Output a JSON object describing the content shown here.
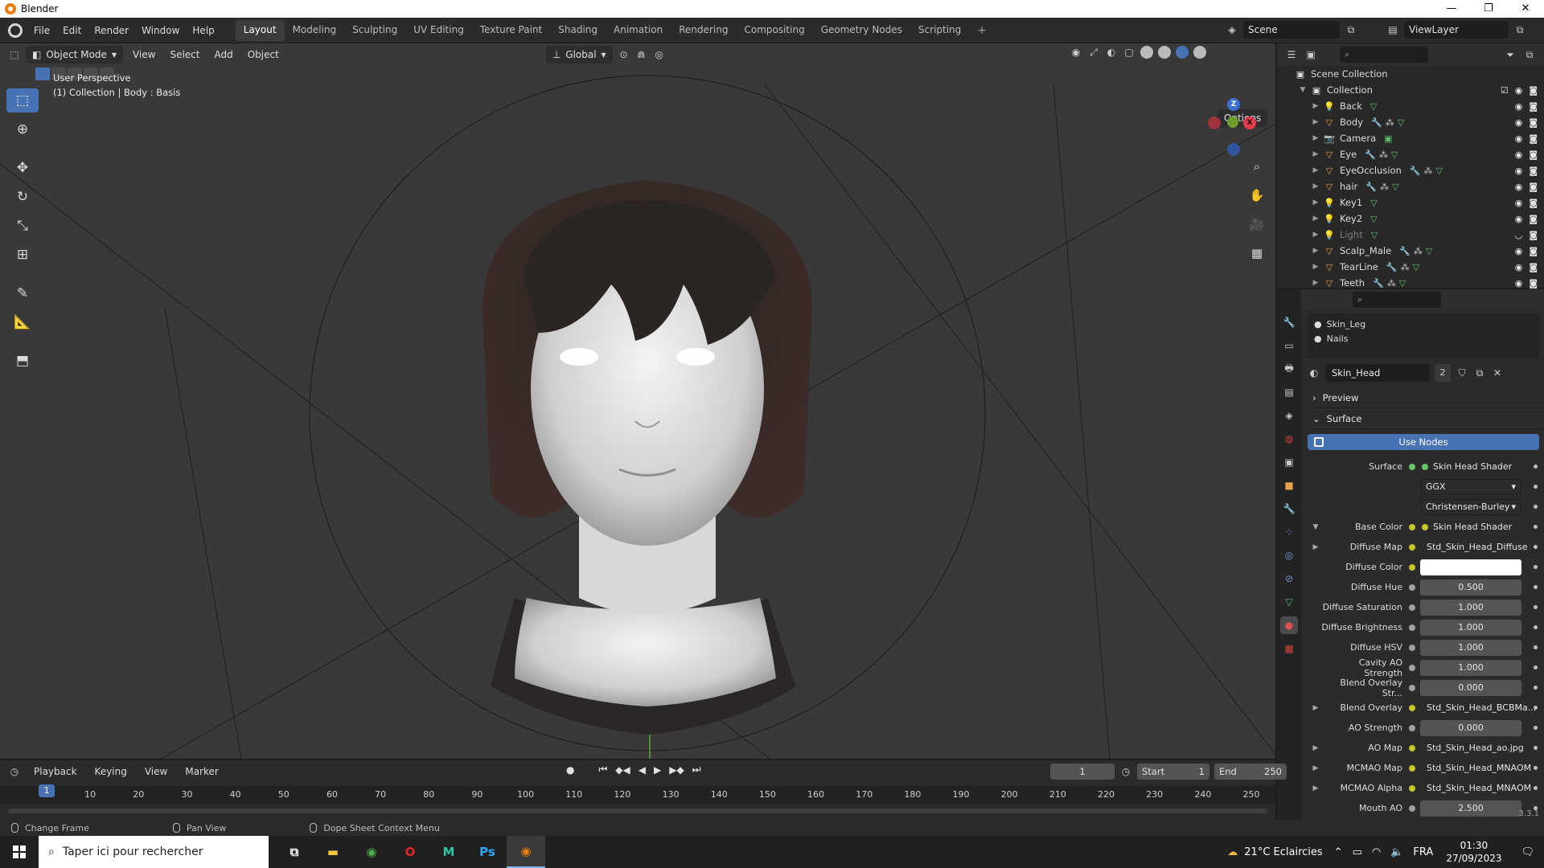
{
  "window": {
    "title": "Blender",
    "controls": [
      "—",
      "❐",
      "✕"
    ]
  },
  "menubar": {
    "menus": [
      "File",
      "Edit",
      "Render",
      "Window",
      "Help"
    ],
    "workspaces": [
      "Layout",
      "Modeling",
      "Sculpting",
      "UV Editing",
      "Texture Paint",
      "Shading",
      "Animation",
      "Rendering",
      "Compositing",
      "Geometry Nodes",
      "Scripting"
    ],
    "active_workspace": "Layout",
    "add_tab": "+",
    "scene": "Scene",
    "view_layer": "ViewLayer"
  },
  "viewport": {
    "mode": "Object Mode",
    "menus": [
      "View",
      "Select",
      "Add",
      "Object"
    ],
    "transform_orientation": "Global",
    "options_label": "Options",
    "info_line1": "User Perspective",
    "info_line2": "(1) Collection | Body : Basis",
    "gizmo": {
      "x": "X",
      "y": "Y",
      "z": "Z"
    },
    "tools": [
      "select-box-icon",
      "cursor-icon",
      "move-icon",
      "rotate-icon",
      "scale-icon",
      "transform-icon",
      "annotate-icon",
      "measure-icon",
      "add-cube-icon"
    ]
  },
  "outliner": {
    "scene_collection": "Scene Collection",
    "collection": "Collection",
    "items": [
      {
        "name": "Back",
        "icon": "light-icon",
        "mods": [
          "constraint"
        ]
      },
      {
        "name": "Body",
        "icon": "mesh-icon",
        "mods": [
          "wrench",
          "armature",
          "mesh-data"
        ]
      },
      {
        "name": "Camera",
        "icon": "camera-icon",
        "mods": [
          "camera-data"
        ]
      },
      {
        "name": "Eye",
        "icon": "mesh-icon",
        "mods": [
          "wrench",
          "armature",
          "mesh-data"
        ]
      },
      {
        "name": "EyeOcclusion",
        "icon": "mesh-icon",
        "mods": [
          "wrench",
          "armature",
          "mesh-data"
        ]
      },
      {
        "name": "hair",
        "icon": "mesh-icon",
        "mods": [
          "wrench",
          "armature",
          "mesh-data"
        ]
      },
      {
        "name": "Key1",
        "icon": "light-icon",
        "mods": [
          "constraint"
        ]
      },
      {
        "name": "Key2",
        "icon": "light-icon",
        "mods": [
          "constraint"
        ]
      },
      {
        "name": "Light",
        "icon": "light-icon",
        "mods": [
          "constraint"
        ],
        "dim": true
      },
      {
        "name": "Scalp_Male",
        "icon": "mesh-icon",
        "mods": [
          "wrench",
          "armature",
          "mesh-data"
        ]
      },
      {
        "name": "TearLine",
        "icon": "mesh-icon",
        "mods": [
          "wrench",
          "armature",
          "mesh-data"
        ]
      },
      {
        "name": "Teeth",
        "icon": "mesh-icon",
        "mods": [
          "wrench",
          "armature",
          "mesh-data"
        ]
      }
    ]
  },
  "properties": {
    "slots": [
      "Skin_Leg",
      "Nails"
    ],
    "material_name": "Skin_Head",
    "material_users": "2",
    "panel_preview": "Preview",
    "panel_surface": "Surface",
    "use_nodes": "Use Nodes",
    "rows": [
      {
        "label": "Surface",
        "value": "Skin Head Shader",
        "kind": "link",
        "sock": "gr",
        "expand": ""
      },
      {
        "label": "",
        "value": "GGX",
        "kind": "select",
        "sock": "",
        "expand": ""
      },
      {
        "label": "",
        "value": "Christensen-Burley",
        "kind": "select",
        "sock": "",
        "expand": ""
      },
      {
        "label": "Base Color",
        "value": "Skin Head Shader",
        "kind": "link",
        "sock": "y",
        "expand": "▼"
      },
      {
        "label": "Diffuse Map",
        "value": "Std_Skin_Head_Diffuse",
        "kind": "link",
        "sock": "y",
        "expand": "▶"
      },
      {
        "label": "Diffuse Color",
        "value": "",
        "kind": "white",
        "sock": "y",
        "expand": ""
      },
      {
        "label": "Diffuse Hue",
        "value": "0.500",
        "kind": "num",
        "sock": "g",
        "expand": ""
      },
      {
        "label": "Diffuse Saturation",
        "value": "1.000",
        "kind": "num",
        "sock": "g",
        "expand": ""
      },
      {
        "label": "Diffuse Brightness",
        "value": "1.000",
        "kind": "num",
        "sock": "g",
        "expand": ""
      },
      {
        "label": "Diffuse HSV",
        "value": "1.000",
        "kind": "num",
        "sock": "g",
        "expand": ""
      },
      {
        "label": "Cavity AO Strength",
        "value": "1.000",
        "kind": "num",
        "sock": "g",
        "expand": ""
      },
      {
        "label": "Blend Overlay Str...",
        "value": "0.000",
        "kind": "num",
        "sock": "g",
        "expand": ""
      },
      {
        "label": "Blend Overlay",
        "value": "Std_Skin_Head_BCBMa...",
        "kind": "link",
        "sock": "y",
        "expand": "▶"
      },
      {
        "label": "AO Strength",
        "value": "0.000",
        "kind": "num",
        "sock": "g",
        "expand": ""
      },
      {
        "label": "AO Map",
        "value": "Std_Skin_Head_ao.jpg",
        "kind": "link",
        "sock": "y",
        "expand": "▶"
      },
      {
        "label": "MCMAO Map",
        "value": "Std_Skin_Head_MNAOM",
        "kind": "link",
        "sock": "y",
        "expand": "▶"
      },
      {
        "label": "MCMAO Alpha",
        "value": "Std_Skin_Head_MNAOM",
        "kind": "link",
        "sock": "y",
        "expand": "▶"
      },
      {
        "label": "Mouth AO",
        "value": "2.500",
        "kind": "num",
        "sock": "g",
        "expand": ""
      }
    ],
    "version": "3.3.1"
  },
  "timeline": {
    "menus": [
      "Playback",
      "Keying",
      "View",
      "Marker"
    ],
    "current_frame": "1",
    "start_label": "Start",
    "start": "1",
    "end_label": "End",
    "end": "250",
    "ticks": [
      "1",
      "10",
      "20",
      "30",
      "40",
      "50",
      "60",
      "70",
      "80",
      "90",
      "100",
      "110",
      "120",
      "130",
      "140",
      "150",
      "160",
      "170",
      "180",
      "190",
      "200",
      "210",
      "220",
      "230",
      "240",
      "250"
    ]
  },
  "statusbar": {
    "left": "Change Frame",
    "middle": "Pan View",
    "right": "Dope Sheet Context Menu"
  },
  "taskbar": {
    "search_placeholder": "Taper ici pour rechercher",
    "weather": "21°C  Eclaircies",
    "lang": "FRA",
    "time": "01:30",
    "date": "27/09/2023",
    "apps": [
      "task-view-icon",
      "file-explorer-icon",
      "chrome-icon",
      "opera-icon",
      "m-app-icon",
      "photoshop-icon",
      "blender-icon"
    ]
  }
}
